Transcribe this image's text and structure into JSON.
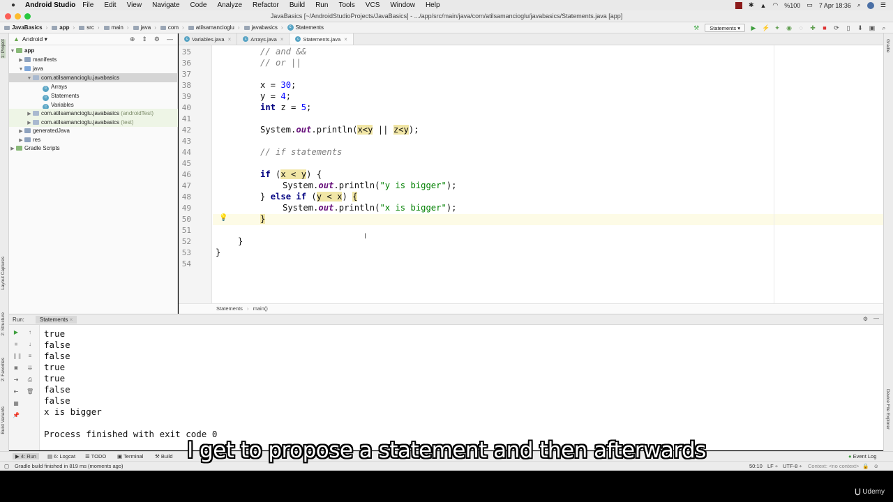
{
  "menubar": {
    "app_name": "Android Studio",
    "items": [
      "File",
      "Edit",
      "View",
      "Navigate",
      "Code",
      "Analyze",
      "Refactor",
      "Build",
      "Run",
      "Tools",
      "VCS",
      "Window",
      "Help"
    ],
    "battery": "%100",
    "clock": "7 Apr  18:36"
  },
  "window": {
    "title": "JavaBasics [~/AndroidStudioProjects/JavaBasics] - .../app/src/main/java/com/atilsamancioglu/javabasics/Statements.java [app]"
  },
  "navbar": {
    "breadcrumbs": [
      "JavaBasics",
      "app",
      "src",
      "main",
      "java",
      "com",
      "atilsamancioglu",
      "javabasics",
      "Statements"
    ],
    "run_config": "Statements"
  },
  "project": {
    "view": "Android",
    "tree": [
      {
        "label": "app",
        "indent": 0,
        "expanded": true
      },
      {
        "label": "manifests",
        "indent": 1,
        "expanded": false
      },
      {
        "label": "java",
        "indent": 1,
        "expanded": true
      },
      {
        "label": "com.atilsamancioglu.javabasics",
        "indent": 2,
        "expanded": true,
        "selected": true
      },
      {
        "label": "Arrays",
        "indent": 3,
        "class": true
      },
      {
        "label": "Statements",
        "indent": 3,
        "class": true
      },
      {
        "label": "Variables",
        "indent": 3,
        "class": true
      },
      {
        "label": "com.atilsamancioglu.javabasics",
        "suffix": "(androidTest)",
        "indent": 2,
        "expanded": false
      },
      {
        "label": "com.atilsamancioglu.javabasics",
        "suffix": "(test)",
        "indent": 2,
        "expanded": false
      },
      {
        "label": "generatedJava",
        "indent": 1,
        "expanded": false
      },
      {
        "label": "res",
        "indent": 1,
        "expanded": false
      },
      {
        "label": "Gradle Scripts",
        "indent": 0,
        "expanded": false
      }
    ]
  },
  "editor": {
    "tabs": [
      {
        "label": "Variables.java",
        "active": false
      },
      {
        "label": "Arrays.java",
        "active": false
      },
      {
        "label": "Statements.java",
        "active": true
      }
    ],
    "line_numbers": [
      "35",
      "36",
      "37",
      "38",
      "39",
      "40",
      "41",
      "42",
      "43",
      "44",
      "45",
      "46",
      "47",
      "48",
      "49",
      "50",
      "51",
      "52",
      "53",
      "54"
    ],
    "code": {
      "l35": "// and &&",
      "l36": "// or ||",
      "l38a": "x = ",
      "l38b": "30",
      "l38c": ";",
      "l39a": "y = ",
      "l39b": "4",
      "l39c": ";",
      "l40a": "int",
      "l40b": " z = ",
      "l40c": "5",
      "l40d": ";",
      "l42a": "System.",
      "l42b": "out",
      "l42c": ".println(",
      "l42d": "x<y",
      "l42e": " || ",
      "l42f": "z<y",
      "l42g": ");",
      "l44": "// if statements",
      "l46a": "if",
      "l46b": " (",
      "l46c": "x < y",
      "l46d": ") {",
      "l47a": "System.",
      "l47b": "out",
      "l47c": ".println(",
      "l47d": "\"y is bigger\"",
      "l47e": ");",
      "l48a": "} ",
      "l48b": "else if",
      "l48c": " (",
      "l48d": "y < x",
      "l48e": ") ",
      "l48f": "{",
      "l49a": "System.",
      "l49b": "out",
      "l49c": ".println(",
      "l49d": "\"x is bigger\"",
      "l49e": ");",
      "l50": "}",
      "l52": "}",
      "l53": "}"
    },
    "breadcrumb": [
      "Statements",
      "main()"
    ]
  },
  "run": {
    "label": "Run:",
    "tab": "Statements",
    "output": [
      "true",
      "false",
      "false",
      "true",
      "true",
      "false",
      "false",
      "x is bigger",
      "",
      "Process finished with exit code 0"
    ]
  },
  "bottom_tabs": {
    "run": "4: Run",
    "logcat": "6: Logcat",
    "todo": "TODO",
    "terminal": "Terminal",
    "build": "Build",
    "event_log": "Event Log"
  },
  "side_tools": {
    "project": "1: Project",
    "layout_captures": "Layout Captures",
    "structure": "2: Structure",
    "favorites": "2: Favorites",
    "build_variants": "Build Variants",
    "gradle": "Gradle",
    "device_file_explorer": "Device File Explorer"
  },
  "status": {
    "message": "Gradle build finished in 819 ms (moments ago)",
    "position": "50:10",
    "line_sep": "LF ÷",
    "encoding": "UTF-8 ÷",
    "context": "Context: <no context>"
  },
  "subtitle": "I get to propose a statement and then afterwards",
  "watermark": "Udemy"
}
